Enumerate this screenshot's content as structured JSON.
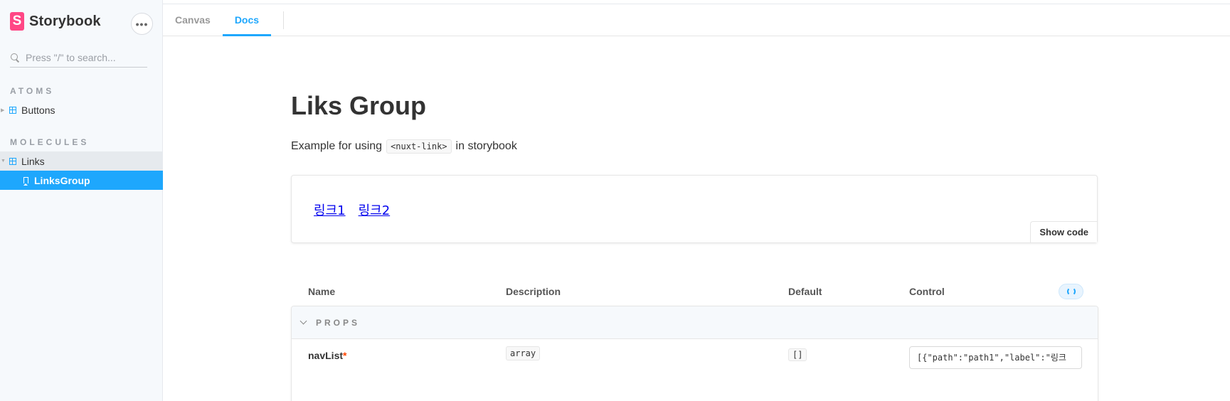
{
  "sidebar": {
    "brand": {
      "logo_letter": "S",
      "name": "Storybook",
      "accent": "#ff4785"
    },
    "menu_label": "•••",
    "search": {
      "placeholder": "Press \"/\" to search..."
    },
    "sections": [
      {
        "title": "ATOMS",
        "items": [
          {
            "label": "Buttons",
            "icon": "component-icon"
          }
        ]
      },
      {
        "title": "MOLECULES",
        "items": [
          {
            "label": "Links",
            "icon": "component-icon",
            "expanded": true
          },
          {
            "label": "LinksGroup",
            "icon": "bookmark-icon",
            "selected": true
          }
        ]
      }
    ],
    "selected_color": "#1ea7fd"
  },
  "toolbar": {
    "tabs": [
      {
        "label": "Canvas",
        "active": false
      },
      {
        "label": "Docs",
        "active": true
      }
    ]
  },
  "docs": {
    "title": "Liks Group",
    "description_before": "Example for using",
    "description_code": "<nuxt-link>",
    "description_after": "in storybook",
    "preview": {
      "links": [
        "링크1",
        "링크2"
      ],
      "show_code_label": "Show code"
    },
    "args_table": {
      "headers": {
        "name": "Name",
        "description": "Description",
        "default": "Default",
        "control": "Control"
      },
      "section_label": "PROPS",
      "rows": [
        {
          "name": "navList",
          "required_mark": "*",
          "type": "array",
          "default": "[]",
          "control_value": "[{\"path\":\"path1\",\"label\":\"링크"
        }
      ]
    }
  }
}
